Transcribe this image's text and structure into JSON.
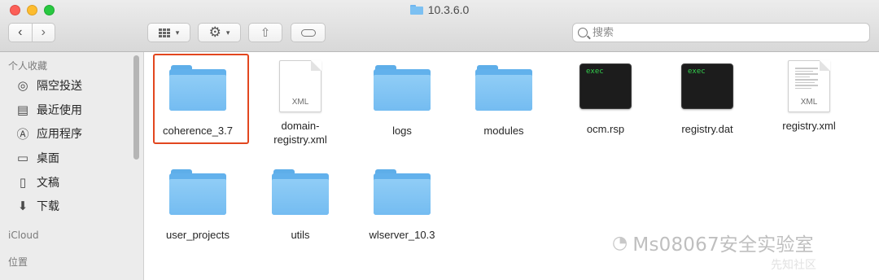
{
  "window": {
    "title": "10.3.6.0"
  },
  "toolbar": {
    "back_glyph": "‹",
    "forward_glyph": "›",
    "view_icon": "grid-view-icon",
    "action_icon": "gear-icon",
    "share_icon": "share-icon",
    "tag_icon": "tag-icon",
    "caret": "▾",
    "share_glyph": "⇧",
    "gear_glyph": "⚙"
  },
  "search": {
    "placeholder": "搜索"
  },
  "sidebar": {
    "favorites_header": "个人收藏",
    "favorites": [
      {
        "label": "隔空投送",
        "icon": "airdrop-icon",
        "glyph": "◎"
      },
      {
        "label": "最近使用",
        "icon": "recents-icon",
        "glyph": "▤"
      },
      {
        "label": "应用程序",
        "icon": "applications-icon",
        "glyph": "Ⓐ"
      },
      {
        "label": "桌面",
        "icon": "desktop-icon",
        "glyph": "▭"
      },
      {
        "label": "文稿",
        "icon": "documents-icon",
        "glyph": "▯"
      },
      {
        "label": "下载",
        "icon": "downloads-icon",
        "glyph": "⬇"
      }
    ],
    "icloud_header": "iCloud",
    "locations_header": "位置"
  },
  "files": [
    {
      "name": "coherence_3.7",
      "kind": "folder",
      "selected": true
    },
    {
      "name": "domain-\nregistry.xml",
      "kind": "xml"
    },
    {
      "name": "logs",
      "kind": "folder"
    },
    {
      "name": "modules",
      "kind": "folder"
    },
    {
      "name": "ocm.rsp",
      "kind": "exec"
    },
    {
      "name": "registry.dat",
      "kind": "exec"
    },
    {
      "name": "registry.xml",
      "kind": "xml-preview"
    },
    {
      "name": "user_projects",
      "kind": "folder"
    },
    {
      "name": "utils",
      "kind": "folder"
    },
    {
      "name": "wlserver_10.3",
      "kind": "folder"
    }
  ],
  "file_icons": {
    "xml_ext": "XML",
    "exec_label": "exec"
  },
  "watermark": {
    "text": "Ms08067安全实验室",
    "sub": "先知社区"
  },
  "colors": {
    "accent_selected": "#e2471f",
    "folder": "#74bcf1",
    "exec_text": "#33d04d"
  }
}
